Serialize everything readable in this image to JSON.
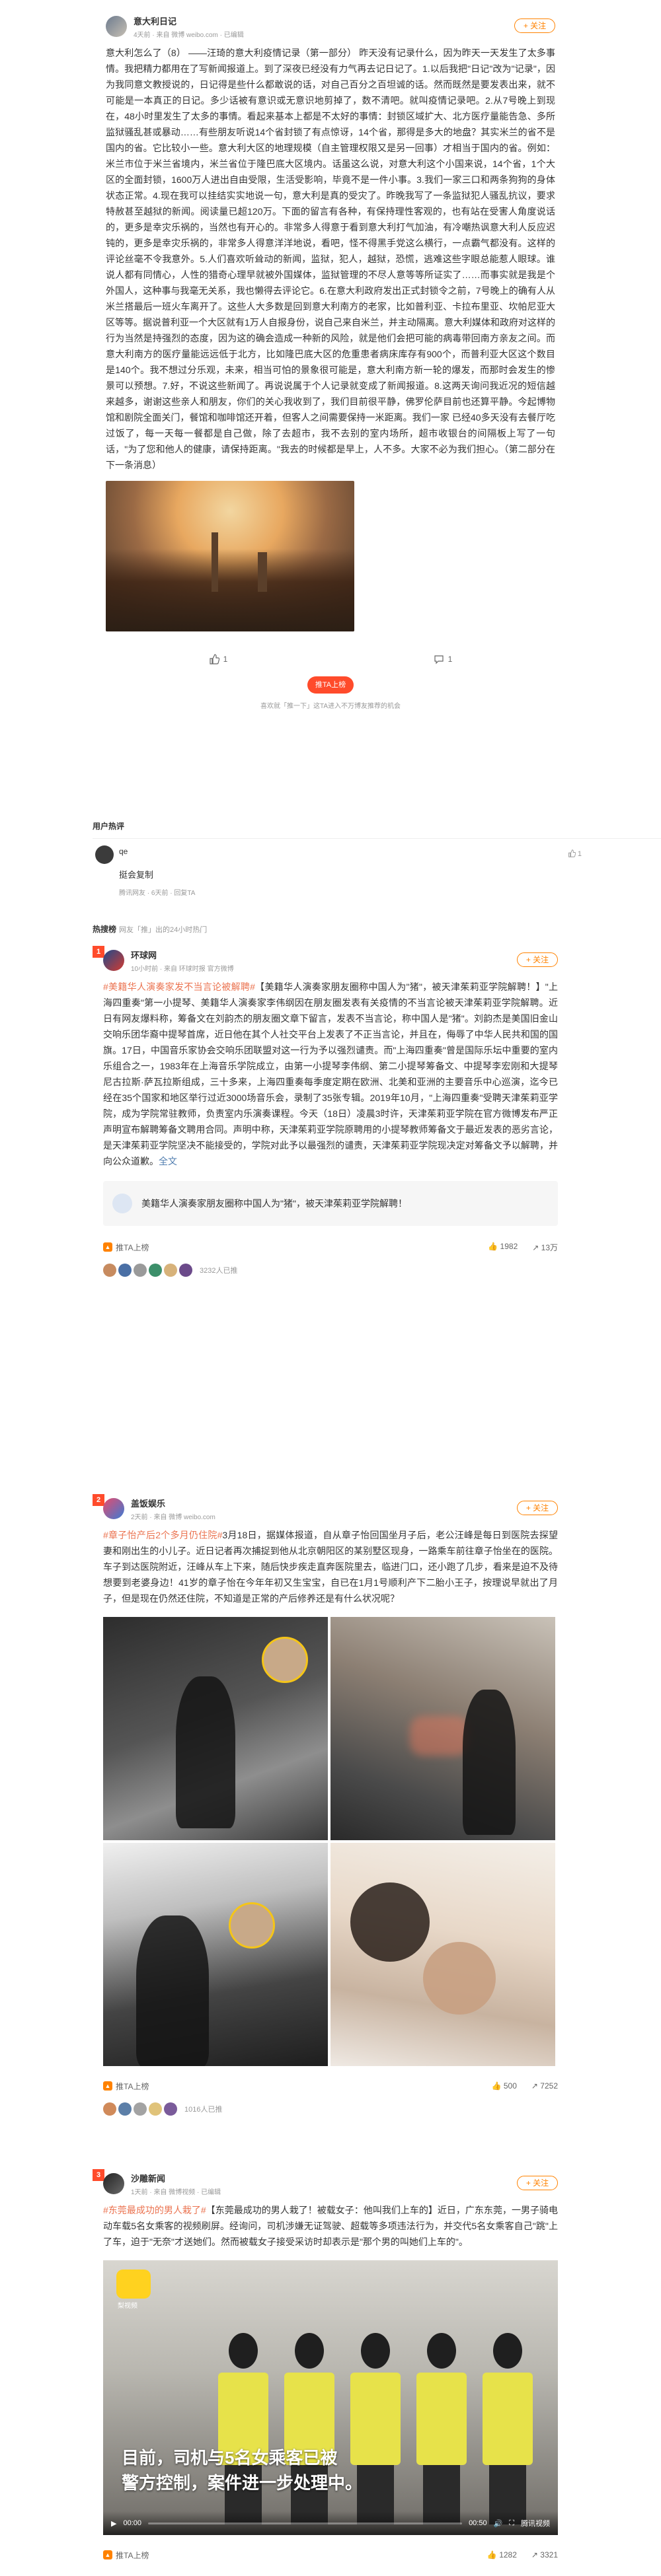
{
  "post": {
    "author": "意大利日记",
    "meta": "4天前 · 来自 微博 weibo.com · 已编辑",
    "follow": "+ 关注",
    "text": "意大利怎么了（8） ——汪琦的意大利疫情记录（第一部分） 昨天没有记录什么，因为昨天一天发生了太多事情。我把精力都用在了写新闻报道上。到了深夜已经没有力气再去记日记了。1.以后我把\"日记\"改为\"记录\"，因为我同意文教授说的，日记得是些什么都敢说的话，对自己百分之百坦诚的话。然而既然是要发表出来，就不可能是一本真正的日记。多少话被有意识或无意识地剪掉了，数不清吧。就叫疫情记录吧。2.从7号晚上到现在，48小时里发生了太多的事情。看起来基本上都是不太好的事情：封锁区域扩大、北方医疗量能告急、多所监狱骚乱甚或暴动……有些朋友听说14个省封锁了有点惊讶，14个省，那得是多大的地盘？其实米兰的省不是国内的省。它比较小一些。意大利大区的地理规模（自主管理权限又是另一回事）才相当于国内的省。例如：米兰市位于米兰省境内，米兰省位于隆巴底大区境内。话虽这么说，对意大利这个小国来说，14个省，1个大区的全面封锁，1600万人进出自由受限，生活受影响，毕竟不是一件小事。3.我们一家三口和两条狗狗的身体状态正常。4.现在我可以挂结实实地说一句，意大利是真的受灾了。昨晚我写了一条监狱犯人骚乱抗议，要求特赦甚至越狱的新闻。阅读量已超120万。下面的留言有各种，有保持理性客观的，也有站在受害人角度说话的，更多是幸灾乐祸的，当然也有开心的。非常多人得意于看到意大利打气加油，有冷嘲热讽意大利人反应迟钝的，更多是幸灾乐祸的，非常多人得意洋洋地说，看吧，怪不得黑手党这么横行，一点霸气都没有。这样的评论丝毫不令我意外。5.人们喜欢听耸动的新闻，监狱，犯人，越狱，恐慌，逃难这些字眼总能惹人眼球。谁说人都有同情心，人性的猎奇心理早就被外国媒体，监狱管理的不尽人意等等所证实了……而事实就是我是个外国人，这种事与我毫无关系，我也懒得去评论它。6.在意大利政府发出正式封锁令之前，7号晚上的确有人从米兰搭最后一班火车离开了。这些人大多数是回到意大利南方的老家，比如普利亚、卡拉布里亚、坎帕尼亚大区等等。据说普利亚一个大区就有1万人自报身份，说自己来自米兰，并主动隔离。意大利媒体和政府对这样的行为当然是持强烈的态度，因为这的确会造成一种新的风险，就是他们会把可能的病毒带回南方亲友之间。而意大利南方的医疗量能远远低于北方，比如隆巴底大区的危重患者病床库存有900个，而普利亚大区这个数目是140个。我不想过分乐观，未来，相当可怕的景象很可能是，意大利南方新一轮的爆发，而那时会发生的惨景可以预想。7.好，不说这些新闻了。再说说属于个人记录就变成了新闻报道。8.这两天询问我近况的短信越来越多，谢谢这些亲人和朋友，你们的关心我收到了，我们目前很平静，佛罗伦萨目前也还算平静。今起博物馆和剧院全面关门，餐馆和咖啡馆还开着，但客人之间需要保持一米距离。我们一家 已经40多天没有去餐厅吃过饭了，每一天每一餐都是自己做，除了去超市，我不去别的室内场所，超市收银台的间隔板上写了一句话，\"为了您和他人的健康，请保持距离。\"我去的时候都是早上，人不多。大家不必为我们担心。（第二部分在下一条消息）",
    "like_count": "1",
    "comment_count": "1",
    "follow_big_btn": "推TA上榜",
    "hint": "喜欢就「推一下」这TA进入不万博友推荐的机会"
  },
  "comments_section": {
    "title": "用户热评",
    "items": [
      {
        "name": "qe",
        "text": "挺会复制",
        "meta": "腾讯网友 · 6天前 · 回复TA",
        "likes": "1"
      }
    ]
  },
  "hot": {
    "title": "热搜榜",
    "subtitle": "网友「推」出的24小时热门"
  },
  "cards": [
    {
      "rank": "1",
      "author": "环球网",
      "meta": "10小时前 · 来自 环球时报 官方微博",
      "follow": "+ 关注",
      "topic": "#美籍华人演奏家发不当言论被解聘#",
      "text": "【美籍华人演奏家朋友圈称中国人为\"猪\"，被天津茱莉亚学院解聘！】\"上海四重奏\"第一小提琴、美籍华人演奏家李伟纲因在朋友圈发表有关疫情的不当言论被天津茱莉亚学院解聘。近日有网友爆料称，筹备文在刘韵杰的朋友圈文章下留言，发表不当言论，称中国人是\"猪\"。刘韵杰是美国旧金山交响乐团华裔中提琴首席，近日他在其个人社交平台上发表了不正当言论，并且在，侮辱了中华人民共和国的国旗。17日，中国音乐家协会交响乐团联盟对这一行为予以强烈谴责。而\"上海四重奏\"曾是国际乐坛中重要的室内乐组合之一，1983年在上海音乐学院成立，由第一小提琴李伟纲、第二小提琴筹备文、中提琴李宏刚和大提琴尼古拉斯·萨瓦拉斯组成，三十多来，上海四重奏每季度定期在欧洲、北美和亚洲的主要音乐中心巡演，迄今已经在35个国家和地区举行过近3000场音乐会，录制了35张专辑。2019年10月，\"上海四重奏\"受聘天津茱莉亚学院，成为学院常驻教师，负责室内乐演奏课程。今天（18日）凌晨3时许，天津茱莉亚学院在官方微博发布严正声明宣布解聘筹备文聘用合同。声明中称，天津茱莉亚学院原聘用的小提琴教师筹备文于最近发表的恶劣言论，是天津茱莉亚学院坚决不能接受的，学院对此予以最强烈的谴责，天津茱莉亚学院现决定对筹备文予以解聘，并向公众道歉。",
      "tail": "全文",
      "quote": "美籍华人演奏家朋友圈称中国人为\"猪\"，被天津茱莉亚学院解聘！",
      "rec_label": "推TA上榜",
      "likes": "1982",
      "shares": "13万",
      "avatars_count": "3232人已推"
    },
    {
      "rank": "2",
      "author": "盖饭娱乐",
      "meta": "2天前 · 来自 微博 weibo.com",
      "follow": "+ 关注",
      "topic": "#章子怡产后2个多月仍住院#",
      "text": "3月18日，据媒体报道，自从章子怡回国坐月子后，老公汪峰是每日到医院去探望妻和刚出生的小儿子。近日记者再次捕捉到他从北京朝阳区的某别墅区现身，一路乘车前往章子怡坐在的医院。车子到达医院附近，汪峰从车上下来，随后快步疾走直奔医院里去，临进门口，还小跑了几步，看来是迫不及待想要到老婆身边！41岁的章子怡在今年年初又生宝宝，自已在1月1号顺利产下二胎小王子，按理说早就出了月子，但是现在仍然还住院，不知道是正常的产后修养还是有什么状况呢？",
      "rec_label": "推TA上榜",
      "likes": "500",
      "shares": "7252",
      "avatars_count": "1016人已推"
    },
    {
      "rank": "3",
      "author": "沙雕新闻",
      "meta": "1天前 · 来自 微博视频 · 已编辑",
      "follow": "+ 关注",
      "topic": "#东莞最成功的男人栽了#",
      "text": "【东莞最成功的男人栽了！被载女子：他叫我们上车的】近日，广东东莞，一男子骑电动车载5名女乘客的视频刷屏。经询问，司机涉嫌无证驾驶、超载等多项违法行为，并交代5名女乘客自己\"跳\"上了车，迫于\"无奈\"才送她们。然而被载女子接受采访时却表示是\"那个男的叫她们上车的\"。",
      "video_caption_1": "目前，司机与5名女乘客已被",
      "video_caption_2": "警方控制，案件进一步处理中。",
      "video_time": "00:00",
      "video_duration": "00:50",
      "video_brand": "腾讯视频",
      "logo_text": "梨视频",
      "rec_label": "推TA上榜",
      "likes": "1282",
      "shares": "3321"
    }
  ],
  "colors": {
    "accent": "#ff8200",
    "topic": "#eb7350",
    "red": "#ff4b2b",
    "text": "#333333"
  }
}
